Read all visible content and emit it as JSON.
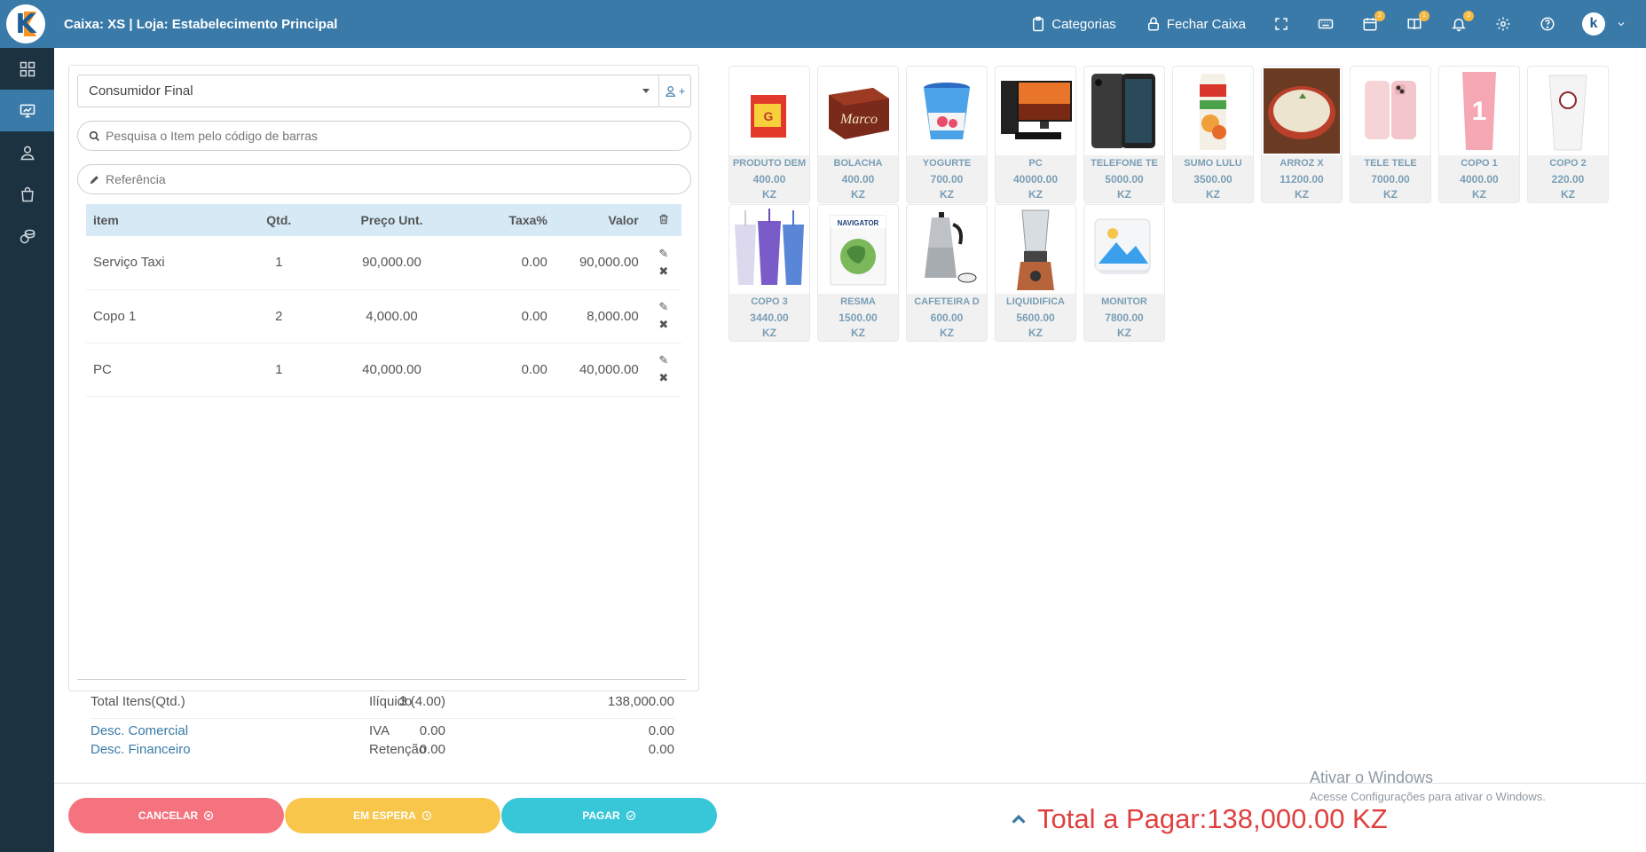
{
  "header": {
    "title": "Caixa: XS | Loja: Estabelecimento Principal",
    "categories_label": "Categorias",
    "close_register_label": "Fechar Caixa",
    "badges": {
      "calendar": "2",
      "book": "1",
      "bell": "3"
    },
    "colors": {
      "bar": "#3a7aa8",
      "sidebar": "#1d3240"
    }
  },
  "sidebar": {
    "items": [
      {
        "icon": "grid-icon",
        "active": false
      },
      {
        "icon": "monitor-chart-icon",
        "active": true
      },
      {
        "icon": "users-icon",
        "active": false
      },
      {
        "icon": "shopping-bag-icon",
        "active": false
      },
      {
        "icon": "coins-icon",
        "active": false
      }
    ]
  },
  "sale": {
    "client": "Consumidor Final",
    "search_placeholder": "Pesquisa o Item pelo código de barras",
    "reference_placeholder": "Referência",
    "columns": {
      "item": "item",
      "qty": "Qtd.",
      "unit_price": "Preço Unt.",
      "tax": "Taxa%",
      "value": "Valor"
    },
    "rows": [
      {
        "item": "Serviço Taxi",
        "qty": "1",
        "unit_price": "90,000.00",
        "tax": "0.00",
        "value": "90,000.00"
      },
      {
        "item": "Copo 1",
        "qty": "2",
        "unit_price": "4,000.00",
        "tax": "0.00",
        "value": "8,000.00"
      },
      {
        "item": "PC",
        "qty": "1",
        "unit_price": "40,000.00",
        "tax": "0.00",
        "value": "40,000.00"
      }
    ]
  },
  "totals": {
    "total_items_label": "Total Itens(Qtd.)",
    "total_items_value": "3 (4.00)",
    "net_label": "Ilíquido",
    "net_value": "138,000.00",
    "commercial_discount_label": "Desc. Comercial",
    "commercial_discount_value": "0.00",
    "vat_label": "IVA",
    "vat_value": "0.00",
    "financial_discount_label": "Desc. Financeiro",
    "financial_discount_value": "0.00",
    "withholding_label": "Retenção",
    "withholding_value": "0.00"
  },
  "products": [
    {
      "name": "PRODUTO DEM",
      "price": "400.00",
      "currency": "KZ",
      "icon": "product-box-icon"
    },
    {
      "name": "BOLACHA",
      "price": "400.00",
      "currency": "KZ",
      "icon": "biscuit-box-icon"
    },
    {
      "name": "YOGURTE",
      "price": "700.00",
      "currency": "KZ",
      "icon": "yogurt-cup-icon"
    },
    {
      "name": "PC",
      "price": "40000.00",
      "currency": "KZ",
      "icon": "desktop-pc-icon"
    },
    {
      "name": "TELEFONE TE",
      "price": "5000.00",
      "currency": "KZ",
      "icon": "smartphone-icon"
    },
    {
      "name": "SUMO LULU",
      "price": "3500.00",
      "currency": "KZ",
      "icon": "juice-carton-icon"
    },
    {
      "name": "ARROZ X",
      "price": "11200.00",
      "currency": "KZ",
      "icon": "rice-bowl-icon"
    },
    {
      "name": "TELE TELE",
      "price": "7000.00",
      "currency": "KZ",
      "icon": "pink-phone-icon"
    },
    {
      "name": "COPO 1",
      "price": "4000.00",
      "currency": "KZ",
      "icon": "pink-cup-icon"
    },
    {
      "name": "COPO 2",
      "price": "220.00",
      "currency": "KZ",
      "icon": "white-cup-icon"
    },
    {
      "name": "COPO 3",
      "price": "3440.00",
      "currency": "KZ",
      "icon": "tumblers-icon"
    },
    {
      "name": "RESMA",
      "price": "1500.00",
      "currency": "KZ",
      "icon": "paper-ream-icon"
    },
    {
      "name": "CAFETEIRA D",
      "price": "600.00",
      "currency": "KZ",
      "icon": "coffee-pot-icon"
    },
    {
      "name": "LIQUIDIFICA",
      "price": "5600.00",
      "currency": "KZ",
      "icon": "blender-icon"
    },
    {
      "name": "MONITOR",
      "price": "7800.00",
      "currency": "KZ",
      "icon": "image-placeholder-icon"
    }
  ],
  "footer": {
    "cancel_label": "CANCELAR",
    "wait_label": "EM ESPERA",
    "pay_label": "PAGAR",
    "total_label": "Total a Pagar:",
    "total_value": "138,000.00 KZ"
  },
  "watermark": {
    "line1": "Ativar o Windows",
    "line2": "Acesse Configurações para ativar o Windows."
  }
}
